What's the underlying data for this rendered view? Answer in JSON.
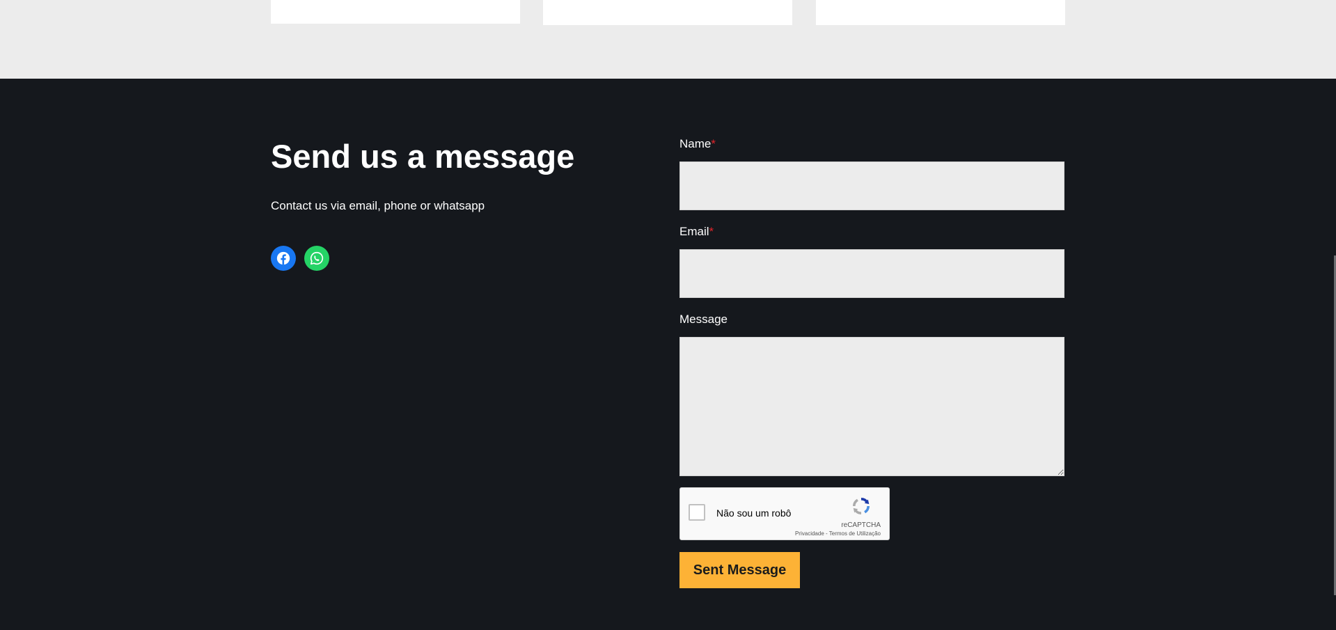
{
  "contact": {
    "heading": "Send us a message",
    "subtext": "Contact us via email, phone or whatsapp",
    "social": [
      {
        "icon": "facebook-icon",
        "color": "#1877f2"
      },
      {
        "icon": "whatsapp-icon",
        "color": "#25d366"
      }
    ]
  },
  "form": {
    "name_label": "Name",
    "email_label": "Email",
    "message_label": "Message",
    "required_mark": "*",
    "name_value": "",
    "email_value": "",
    "message_value": "",
    "submit_label": "Sent Message"
  },
  "recaptcha": {
    "checkbox_label": "Não sou um robô",
    "brand": "reCAPTCHA",
    "privacy_link": "Privacidade",
    "separator": " - ",
    "terms_link": "Termos de Utilização"
  },
  "colors": {
    "footer_bg": "#15181d",
    "top_band_bg": "#ececec",
    "accent": "#fdb236",
    "required": "#e0242a"
  }
}
